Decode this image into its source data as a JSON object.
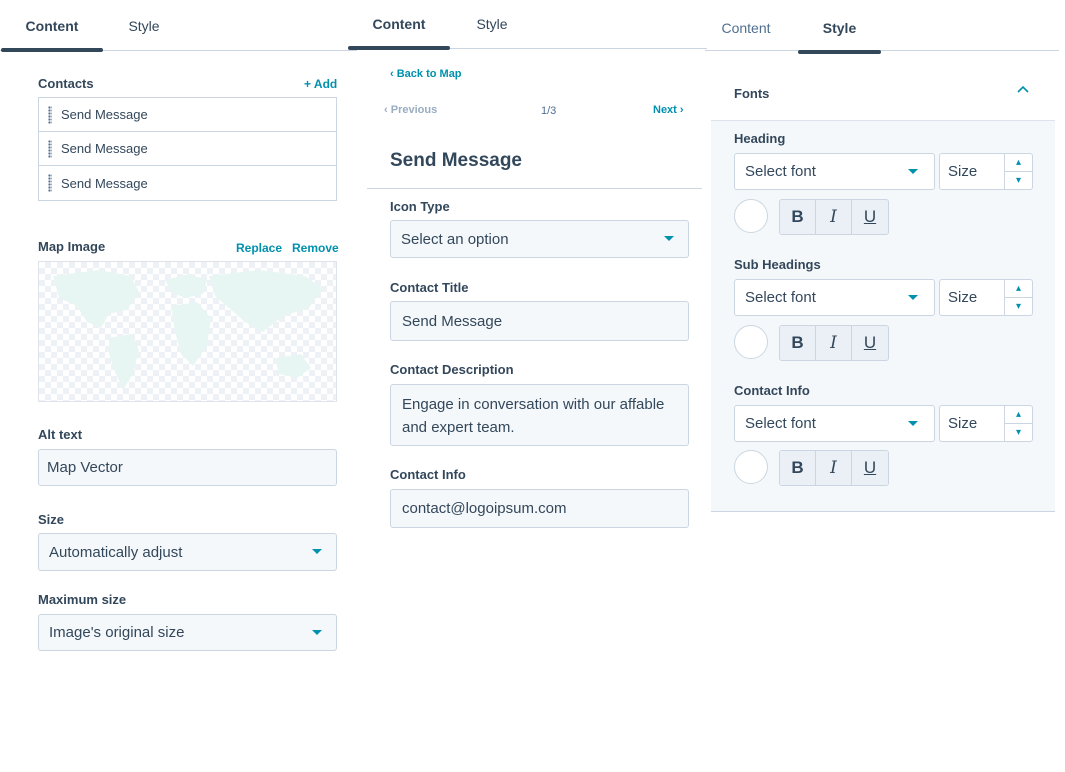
{
  "panel_a": {
    "tabs": [
      "Content",
      "Style"
    ],
    "contacts": {
      "label": "Contacts",
      "add_label": "+ Add",
      "items": [
        "Send Message",
        "Send Message",
        "Send Message"
      ]
    },
    "map_image": {
      "label": "Map Image",
      "replace_label": "Replace",
      "remove_label": "Remove"
    },
    "alt_text": {
      "label": "Alt text",
      "value": "Map Vector"
    },
    "size": {
      "label": "Size",
      "value": "Automatically adjust"
    },
    "max_size": {
      "label": "Maximum size",
      "value": "Image's original size"
    }
  },
  "panel_b": {
    "tabs": [
      "Content",
      "Style"
    ],
    "back_label": "Back to Map",
    "pager": {
      "previous_label": "Previous",
      "count": "1/3",
      "next_label": "Next"
    },
    "title": "Send Message",
    "icon_type": {
      "label": "Icon Type",
      "value": "Select an option"
    },
    "contact_title": {
      "label": "Contact Title",
      "value": "Send Message"
    },
    "contact_description": {
      "label": "Contact Description",
      "value": "Engage in conversation with our affable and expert team."
    },
    "contact_info": {
      "label": "Contact Info",
      "value": "contact@logoipsum.com"
    }
  },
  "panel_c": {
    "tabs": [
      "Content",
      "Style"
    ],
    "fonts_label": "Fonts",
    "groups": [
      {
        "label": "Heading",
        "font_value": "Select font",
        "size_placeholder": "Size"
      },
      {
        "label": "Sub Headings",
        "font_value": "Select font",
        "size_placeholder": "Size"
      },
      {
        "label": "Contact Info",
        "font_value": "Select font",
        "size_placeholder": "Size"
      }
    ],
    "style_buttons": [
      "B",
      "I",
      "U"
    ]
  },
  "colors": {
    "accent": "#0091ae",
    "text": "#33475b",
    "border": "#cbd6e2",
    "field_bg": "#f5f8fa"
  }
}
